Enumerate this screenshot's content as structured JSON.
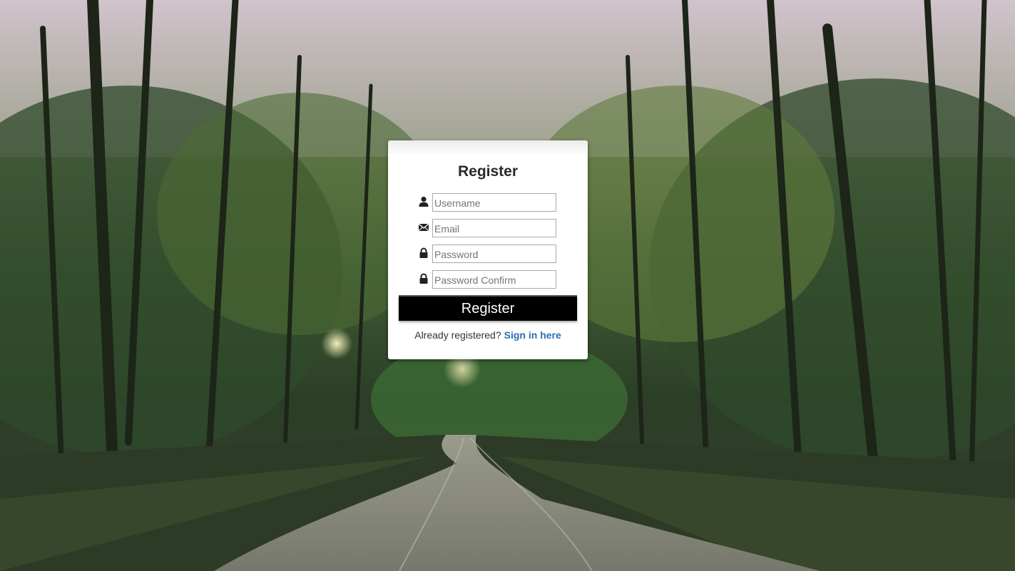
{
  "register_form": {
    "title": "Register",
    "fields": [
      {
        "icon": "user-icon",
        "placeholder": "Username",
        "value": ""
      },
      {
        "icon": "envelope-icon",
        "placeholder": "Email",
        "value": ""
      },
      {
        "icon": "lock-icon",
        "placeholder": "Password",
        "value": ""
      },
      {
        "icon": "lock-icon",
        "placeholder": "Password Confirm",
        "value": ""
      }
    ],
    "submit_label": "Register",
    "footer_text": "Already registered?",
    "signin_link": "Sign in here"
  },
  "colors": {
    "button_bg": "#000000",
    "link": "#2a6fb5",
    "card_bg": "#ffffff"
  },
  "background": {
    "icon": "forest-road-photo"
  }
}
